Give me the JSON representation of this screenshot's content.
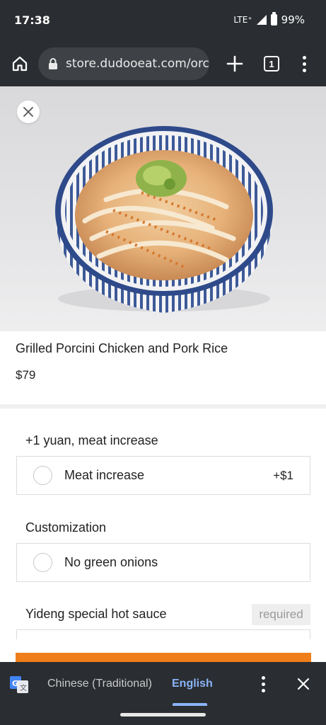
{
  "status_bar": {
    "time": "17:38",
    "network": "LTE⁺",
    "battery": "99%"
  },
  "browser": {
    "url": "store.dudooeat.com/orc",
    "tab_count": "1",
    "icons": [
      "home-icon",
      "lock-icon",
      "plus-icon",
      "tabs-icon",
      "more-vert-icon"
    ]
  },
  "product": {
    "name": "Grilled Porcini Chicken and Pork Rice",
    "price": "$79"
  },
  "option_groups": [
    {
      "title": "+1 yuan, meat increase",
      "options": [
        {
          "label": "Meat increase",
          "price": "+$1"
        }
      ]
    },
    {
      "title": "Customization",
      "options": [
        {
          "label": "No green onions"
        }
      ]
    },
    {
      "title": "Yideng special hot sauce",
      "badge": "required"
    }
  ],
  "translate_bar": {
    "source_language": "Chinese (Traditional)",
    "target_language": "English"
  },
  "colors": {
    "chrome_dark": "#2a2d31",
    "accent_orange": "#ef7d1a",
    "translate_blue": "#8ab4f8"
  }
}
